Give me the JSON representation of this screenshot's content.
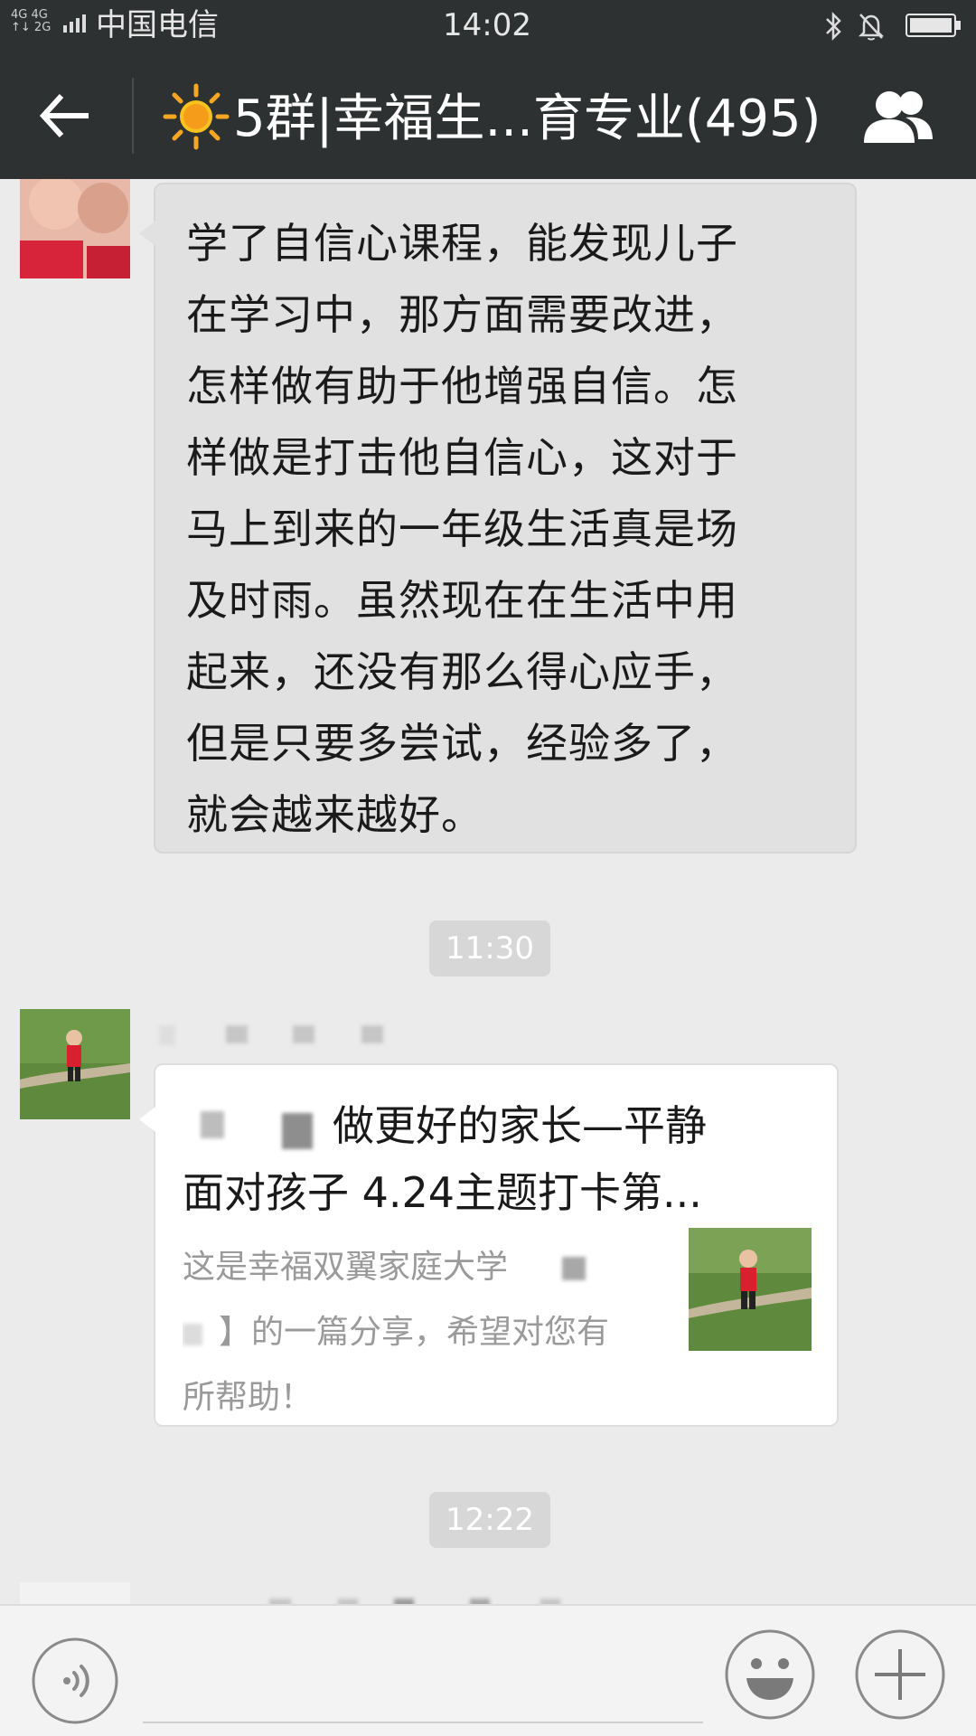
{
  "status_bar": {
    "network_top": "4G 4G",
    "network_bottom": "↑↓ 2G",
    "carrier": "中国电信",
    "time": "14:02",
    "icons": [
      "bluetooth-icon",
      "bell-muted-icon",
      "battery-icon"
    ]
  },
  "header": {
    "title": "5群|幸福生...育专业(495)",
    "back_icon": "arrow-left-icon",
    "title_icon": "sun-icon",
    "members_icon": "group-members-icon"
  },
  "messages": {
    "text_message": {
      "lines": [
        "学了自信心课程，能发现儿子",
        "在学习中，那方面需要改进，",
        "怎样做有助于他增强自信。怎",
        "样做是打击他自信心，这对于",
        "马上到来的一年级生活真是场",
        "及时雨。虽然现在在生活中用",
        "起来，还没有那么得心应手，",
        "但是只要多尝试，经验多了，",
        "就会越来越好。"
      ]
    },
    "timestamp_1": "11:30",
    "link_message": {
      "title_line_1": "做更好的家长—平静",
      "title_line_2": "面对孩子  4.24主题打卡第...",
      "desc_line_1": "这是幸福双翼家庭大学",
      "desc_line_2": "】的一篇分享，希望对您有",
      "desc_line_3": "所帮助！"
    },
    "timestamp_2": "12:22"
  },
  "input_bar": {
    "voice_icon": "voice-icon",
    "emoji_icon": "emoji-icon",
    "plus_icon": "plus-icon",
    "input_value": ""
  },
  "colors": {
    "header_bg": "#2e3132",
    "chat_bg": "#ebebeb",
    "bubble_gray": "#e1e1e1",
    "link_bubble": "#ffffff",
    "time_chip": "#d7d7d7"
  }
}
